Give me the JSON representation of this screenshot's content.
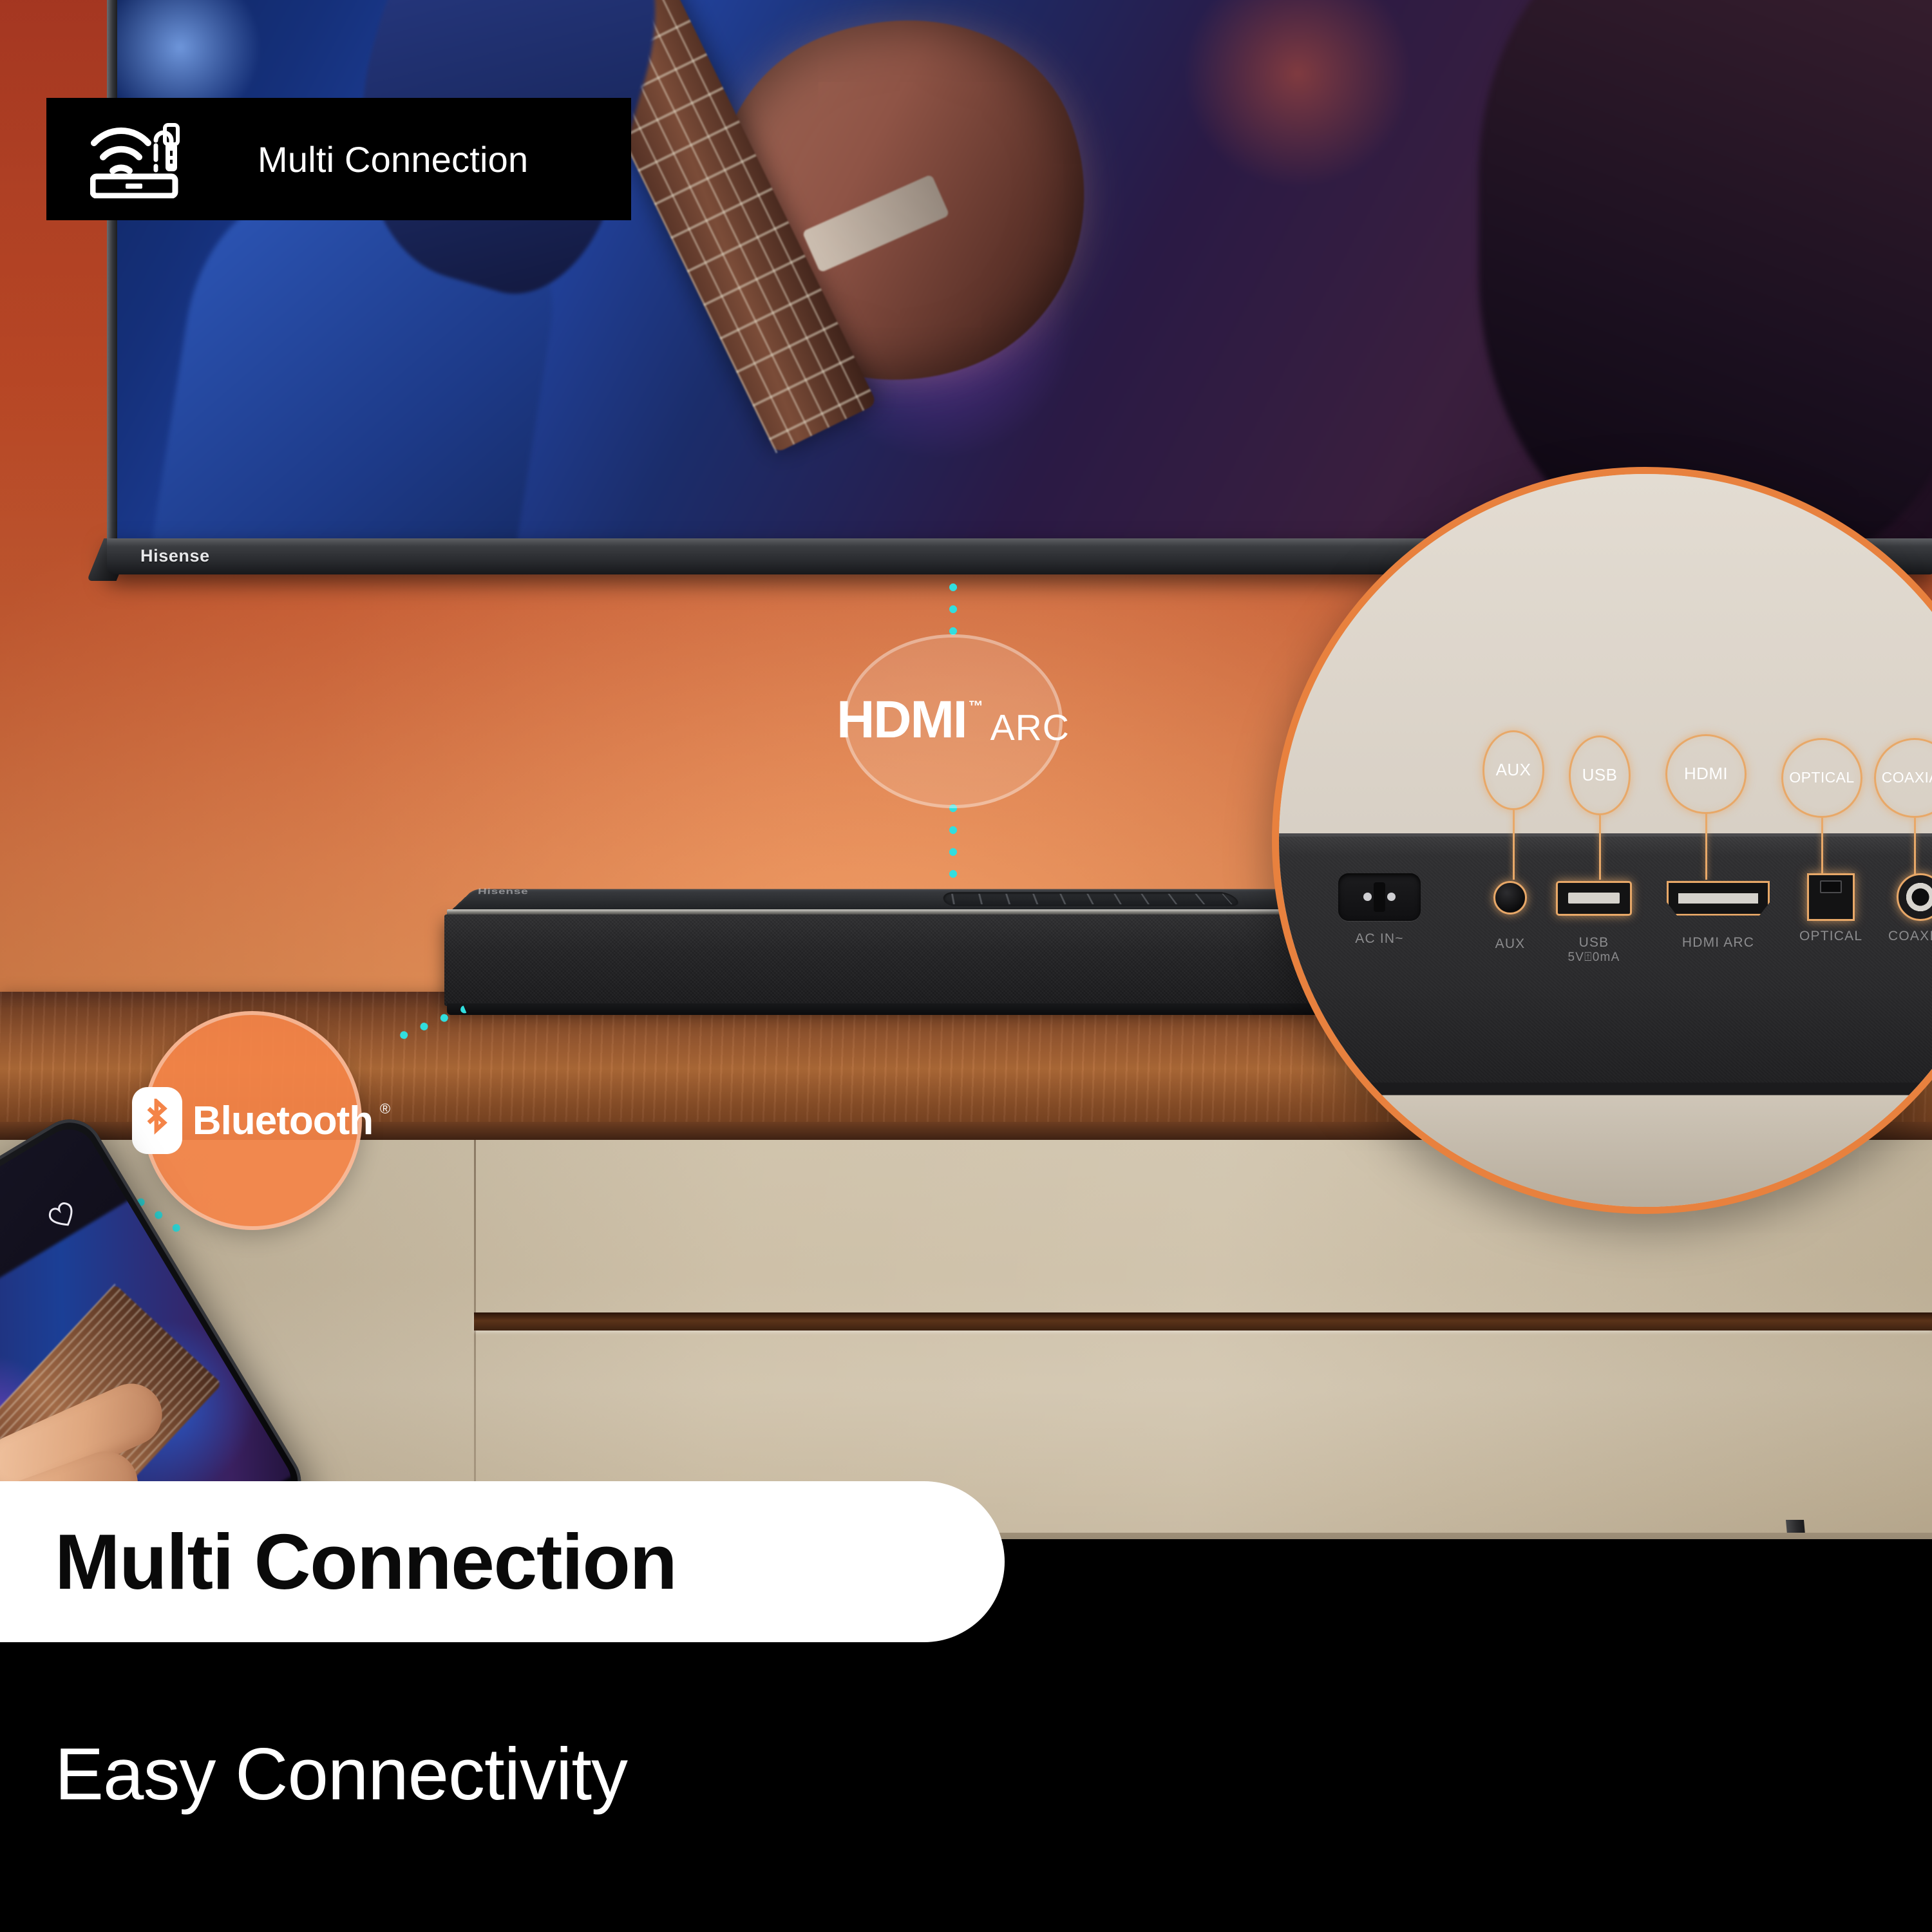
{
  "top_badge": {
    "title": "Multi Connection",
    "icons": [
      "wifi-signal-icon",
      "audio-jack-cable-icon",
      "soundbar-icon"
    ],
    "background_color": "#000000",
    "text_color": "#FFFFFF"
  },
  "scene": {
    "tv": {
      "brand": "Hisense",
      "content_description": "concert guitarist stage"
    },
    "soundbar": {
      "brand": "Hisense"
    },
    "wall_color": "#D9572F",
    "shelf_color": "#9A5A31",
    "cabinet_color": "#C8B99E",
    "connector_color": "#31DEDE"
  },
  "hdmi_badge": {
    "wordmark": "HDMI",
    "trademark": "™",
    "suffix": "ARC",
    "ring_color": "#FFFFFF"
  },
  "bluetooth_badge": {
    "label": "Bluetooth",
    "registered": "®",
    "circle_color": "#F48448",
    "text_color": "#FFFFFF"
  },
  "magnifier": {
    "ring_color": "#E8813E",
    "accent_color": "#E8A868",
    "callouts": [
      {
        "label": "AUX"
      },
      {
        "label": "USB"
      },
      {
        "label": "HDMI"
      },
      {
        "label": "OPTICAL"
      },
      {
        "label": "COAXIAL"
      }
    ],
    "ports": [
      {
        "label": "AC IN~",
        "sub": "",
        "type": "ac-power-port"
      },
      {
        "label": "AUX",
        "sub": "",
        "type": "aux-jack-port"
      },
      {
        "label": "USB",
        "sub": "5V⍐0mA",
        "type": "usb-port"
      },
      {
        "label": "HDMI ARC",
        "sub": "",
        "type": "hdmi-port"
      },
      {
        "label": "OPTICAL",
        "sub": "",
        "type": "optical-port"
      },
      {
        "label": "COAXIAL",
        "sub": "",
        "type": "coaxial-port"
      }
    ]
  },
  "footer": {
    "headline": "Multi Connection",
    "subheadline": "Easy Connectivity",
    "pill_color": "#FFFFFF",
    "band_color": "#000000"
  }
}
